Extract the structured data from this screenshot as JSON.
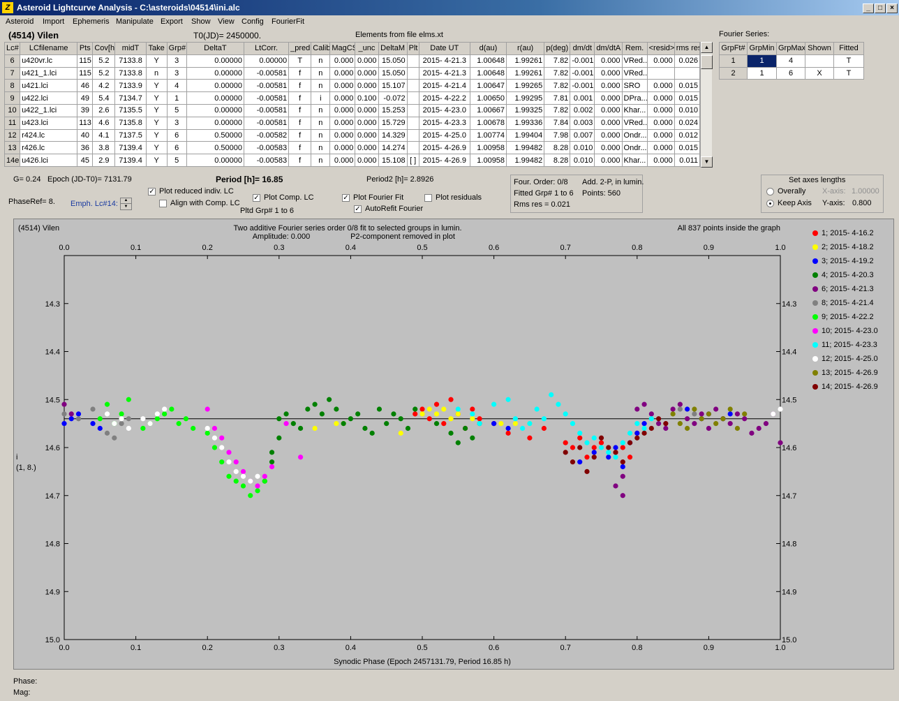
{
  "window": {
    "title": "Asteroid Lightcurve Analysis - C:\\asteroids\\04514\\ini.alc",
    "icon_label": "Z",
    "min": "_",
    "max": "□",
    "close": "×"
  },
  "menu": [
    "Asteroid",
    "Import",
    "Ephemeris",
    "Manipulate",
    "Export",
    "Show",
    "View",
    "Config",
    "FourierFit"
  ],
  "header": {
    "asteroid": "(4514) Vilen",
    "t0": "T0(JD)= 2450000.",
    "elements": "Elements from file elms.xt",
    "fourier_title": "Fourier Series:"
  },
  "lc_table": {
    "columns": [
      "Lc#",
      "LCfilename",
      "Pts",
      "Cov[h]",
      "midT",
      "Take",
      "Grp#",
      "DeltaT",
      "LtCorr.",
      "_pred.",
      "Calib.",
      "MagCS",
      "_unc",
      "DeltaM",
      "Plt",
      "Date UT",
      "d(au)",
      "r(au)",
      "p(deg)",
      "dm/dt",
      "dm/dtA",
      "Rem.",
      "<resid>",
      "rms res"
    ],
    "rows": [
      [
        "6",
        "u420vr.lc",
        "115",
        "5.2",
        "7133.8",
        "Y",
        "3",
        "0.00000",
        "0.00000",
        "T",
        "n",
        "0.000",
        "0.000",
        "15.050",
        "",
        "2015- 4-21.3",
        "1.00648",
        "1.99261",
        "7.82",
        "-0.001",
        "0.000",
        "VRed...",
        "0.000",
        "0.026"
      ],
      [
        "7",
        "u421_1.lci",
        "115",
        "5.2",
        "7133.8",
        "n",
        "3",
        "0.00000",
        "-0.00581",
        "f",
        "n",
        "0.000",
        "0.000",
        "15.050",
        "",
        "2015- 4-21.3",
        "1.00648",
        "1.99261",
        "7.82",
        "-0.001",
        "0.000",
        "VRed...",
        "",
        ""
      ],
      [
        "8",
        "u421.lci",
        "46",
        "4.2",
        "7133.9",
        "Y",
        "4",
        "0.00000",
        "-0.00581",
        "f",
        "n",
        "0.000",
        "0.000",
        "15.107",
        "",
        "2015- 4-21.4",
        "1.00647",
        "1.99265",
        "7.82",
        "-0.001",
        "0.000",
        "SRO",
        "0.000",
        "0.015"
      ],
      [
        "9",
        "u422.lci",
        "49",
        "5.4",
        "7134.7",
        "Y",
        "1",
        "0.00000",
        "-0.00581",
        "f",
        "i",
        "0.000",
        "0.100",
        "-0.072",
        "",
        "2015- 4-22.2",
        "1.00650",
        "1.99295",
        "7.81",
        "0.001",
        "0.000",
        "DPra...",
        "0.000",
        "0.015"
      ],
      [
        "10",
        "u422_1.lci",
        "39",
        "2.6",
        "7135.5",
        "Y",
        "5",
        "0.00000",
        "-0.00581",
        "f",
        "n",
        "0.000",
        "0.000",
        "15.253",
        "",
        "2015- 4-23.0",
        "1.00667",
        "1.99325",
        "7.82",
        "0.002",
        "0.000",
        "Khar...",
        "0.000",
        "0.010"
      ],
      [
        "11",
        "u423.lci",
        "113",
        "4.6",
        "7135.8",
        "Y",
        "3",
        "0.00000",
        "-0.00581",
        "f",
        "n",
        "0.000",
        "0.000",
        "15.729",
        "",
        "2015- 4-23.3",
        "1.00678",
        "1.99336",
        "7.84",
        "0.003",
        "0.000",
        "VRed...",
        "0.000",
        "0.024"
      ],
      [
        "12",
        "r424.lc",
        "40",
        "4.1",
        "7137.5",
        "Y",
        "6",
        "0.50000",
        "-0.00582",
        "f",
        "n",
        "0.000",
        "0.000",
        "14.329",
        "",
        "2015- 4-25.0",
        "1.00774",
        "1.99404",
        "7.98",
        "0.007",
        "0.000",
        "Ondr...",
        "0.000",
        "0.012"
      ],
      [
        "13",
        "r426.lc",
        "36",
        "3.8",
        "7139.4",
        "Y",
        "6",
        "0.50000",
        "-0.00583",
        "f",
        "n",
        "0.000",
        "0.000",
        "14.274",
        "",
        "2015- 4-26.9",
        "1.00958",
        "1.99482",
        "8.28",
        "0.010",
        "0.000",
        "Ondr...",
        "0.000",
        "0.015"
      ],
      [
        "14e",
        "u426.lci",
        "45",
        "2.9",
        "7139.4",
        "Y",
        "5",
        "0.00000",
        "-0.00583",
        "f",
        "n",
        "0.000",
        "0.000",
        "15.108",
        "[ ]",
        "2015- 4-26.9",
        "1.00958",
        "1.99482",
        "8.28",
        "0.010",
        "0.000",
        "Khar...",
        "0.000",
        "0.011"
      ]
    ]
  },
  "fourier_table": {
    "columns": [
      "GrpFt#",
      "GrpMin",
      "GrpMax",
      "Shown",
      "Fitted"
    ],
    "rows": [
      [
        "1",
        "1",
        "4",
        "",
        "T"
      ],
      [
        "2",
        "1",
        "6",
        "X",
        "T"
      ]
    ]
  },
  "controls": {
    "g": "G= 0.24",
    "epoch": "Epoch (JD-T0)= 7131.79",
    "period": "Period [h]= 16.85",
    "period2": "Period2 [h]= 2.8926",
    "phaseref": "PhaseRef= 8.",
    "emph": "Emph. Lc#14:",
    "plot_reduced": "Plot reduced indiv. LC",
    "align": "Align with Comp. LC",
    "plot_comp": "Plot Comp. LC",
    "pltd_grp": "Pltd Grp#  1   to   6",
    "plot_fourier": "Plot Fourier Fit",
    "autorefit": "AutoRefit Fourier",
    "plot_residuals": "Plot residuals",
    "four_order": "Four. Order:  0/8",
    "add2p": "Add. 2-P, in lumin.",
    "fitted_grp": "Fitted Grp# 1 to 6",
    "points": "Points: 560",
    "rms": "Rms res     = 0.021",
    "axes_title": "Set axes lengths",
    "overally": "Overally",
    "keep_axis": "Keep Axis",
    "xaxis_label": "X-axis:",
    "xaxis_val": "1.00000",
    "yaxis_label": "Y-axis:",
    "yaxis_val": "0.800",
    "checked_mark": "✓"
  },
  "chart_data": {
    "type": "scatter",
    "title_left": "(4514) Vilen",
    "title_center": "Two additive Fourier series order 0/8 fit to selected groups in lumin.",
    "subtitle_amp": "Amplitude: 0.000",
    "subtitle_p2": "P2-component removed in plot",
    "title_right": "All 837 points inside the graph",
    "xlabel": "Synodic Phase (Epoch 2457131.79, Period 16.85 h)",
    "ylabel": "i",
    "ylabel2": "(1, 8.)",
    "xlim": [
      0,
      1
    ],
    "ylim": [
      14.2,
      15.0
    ],
    "xticks": [
      "0.0",
      "0.1",
      "0.2",
      "0.3",
      "0.4",
      "0.5",
      "0.6",
      "0.7",
      "0.8",
      "0.9",
      "1.0"
    ],
    "yticks": [
      "14.3",
      "14.4",
      "14.5",
      "14.6",
      "14.7",
      "14.8",
      "14.9",
      "15.0"
    ],
    "fit_line": 14.54,
    "series": [
      {
        "name": "1; 2015- 4-16.2",
        "color": "#ff0000",
        "x": [
          0.49,
          0.5,
          0.51,
          0.52,
          0.53,
          0.54,
          0.55,
          0.56,
          0.57,
          0.58,
          0.6,
          0.62,
          0.65,
          0.67,
          0.7,
          0.71,
          0.72,
          0.73,
          0.74,
          0.75,
          0.77,
          0.78,
          0.79,
          0.8
        ],
        "y": [
          14.53,
          14.52,
          14.54,
          14.51,
          14.55,
          14.5,
          14.53,
          14.56,
          14.52,
          14.54,
          14.55,
          14.57,
          14.58,
          14.56,
          14.59,
          14.6,
          14.58,
          14.62,
          14.6,
          14.59,
          14.61,
          14.6,
          14.62,
          14.57
        ]
      },
      {
        "name": "2; 2015- 4-18.2",
        "color": "#ffff00",
        "x": [
          0.35,
          0.38,
          0.39,
          0.47,
          0.5,
          0.51,
          0.52,
          0.53,
          0.54,
          0.55,
          0.57,
          0.61,
          0.63,
          0.65
        ],
        "y": [
          14.56,
          14.55,
          14.55,
          14.57,
          14.53,
          14.52,
          14.53,
          14.52,
          14.54,
          14.53,
          14.54,
          14.55,
          14.55,
          14.55
        ]
      },
      {
        "name": "3; 2015- 4-19.2",
        "color": "#0000ff",
        "x": [
          0.0,
          0.01,
          0.02,
          0.04,
          0.05,
          0.6,
          0.62,
          0.72,
          0.74,
          0.76,
          0.77,
          0.78,
          0.79,
          0.8,
          0.81,
          0.87,
          0.89,
          0.9,
          0.92,
          0.93
        ],
        "y": [
          14.55,
          14.54,
          14.53,
          14.55,
          14.56,
          14.55,
          14.56,
          14.63,
          14.61,
          14.62,
          14.6,
          14.64,
          14.59,
          14.57,
          14.55,
          14.52,
          14.54,
          14.53,
          14.54,
          14.53
        ]
      },
      {
        "name": "4; 2015- 4-20.3",
        "color": "#008000",
        "x": [
          0.3,
          0.31,
          0.32,
          0.33,
          0.34,
          0.35,
          0.36,
          0.37,
          0.38,
          0.39,
          0.4,
          0.41,
          0.42,
          0.43,
          0.44,
          0.45,
          0.46,
          0.47,
          0.48,
          0.49,
          0.52,
          0.54,
          0.55,
          0.56,
          0.57,
          0.58,
          0.29,
          0.28,
          0.29,
          0.3
        ],
        "y": [
          14.54,
          14.53,
          14.55,
          14.56,
          14.52,
          14.51,
          14.53,
          14.5,
          14.52,
          14.55,
          14.54,
          14.53,
          14.56,
          14.57,
          14.52,
          14.55,
          14.53,
          14.54,
          14.56,
          14.52,
          14.55,
          14.57,
          14.59,
          14.56,
          14.58,
          14.55,
          14.63,
          14.67,
          14.61,
          14.58
        ]
      },
      {
        "name": "6; 2015- 4-21.3",
        "color": "#800080",
        "x": [
          0.0,
          0.01,
          0.8,
          0.81,
          0.82,
          0.83,
          0.84,
          0.85,
          0.86,
          0.87,
          0.88,
          0.89,
          0.9,
          0.91,
          0.92,
          0.93,
          0.94,
          0.95,
          0.96,
          0.97,
          0.98,
          0.99,
          1.0,
          0.78,
          0.77,
          0.78
        ],
        "y": [
          14.51,
          14.53,
          14.52,
          14.51,
          14.53,
          14.55,
          14.56,
          14.52,
          14.51,
          14.54,
          14.55,
          14.53,
          14.56,
          14.52,
          14.54,
          14.55,
          14.53,
          14.54,
          14.57,
          14.56,
          14.55,
          14.53,
          14.59,
          14.66,
          14.68,
          14.7
        ]
      },
      {
        "name": "8; 2015- 4-21.4",
        "color": "#808080",
        "x": [
          0.0,
          0.02,
          0.04,
          0.06,
          0.07,
          0.08,
          0.09,
          0.86,
          0.88
        ],
        "y": [
          14.53,
          14.54,
          14.52,
          14.57,
          14.58,
          14.55,
          14.54,
          14.52,
          14.53
        ]
      },
      {
        "name": "9; 2015- 4-22.2",
        "color": "#00ff00",
        "x": [
          0.05,
          0.06,
          0.07,
          0.08,
          0.09,
          0.11,
          0.12,
          0.13,
          0.14,
          0.15,
          0.16,
          0.17,
          0.18,
          0.2,
          0.21,
          0.22,
          0.23,
          0.24,
          0.25,
          0.26,
          0.27,
          0.28
        ],
        "y": [
          14.54,
          14.51,
          14.55,
          14.53,
          14.5,
          14.56,
          14.55,
          14.54,
          14.53,
          14.52,
          14.55,
          14.54,
          14.56,
          14.57,
          14.6,
          14.63,
          14.66,
          14.67,
          14.68,
          14.7,
          14.69,
          14.67
        ]
      },
      {
        "name": "10; 2015- 4-23.0",
        "color": "#ff00ff",
        "x": [
          0.2,
          0.21,
          0.22,
          0.23,
          0.24,
          0.25,
          0.26,
          0.27,
          0.28,
          0.29,
          0.31,
          0.33
        ],
        "y": [
          14.52,
          14.56,
          14.58,
          14.61,
          14.63,
          14.65,
          14.67,
          14.68,
          14.66,
          14.64,
          14.55,
          14.62
        ]
      },
      {
        "name": "11; 2015- 4-23.3",
        "color": "#00ffff",
        "x": [
          0.55,
          0.57,
          0.58,
          0.6,
          0.62,
          0.63,
          0.64,
          0.65,
          0.66,
          0.67,
          0.68,
          0.69,
          0.7,
          0.71,
          0.72,
          0.73,
          0.74,
          0.75,
          0.76,
          0.77,
          0.78,
          0.79,
          0.8,
          0.81,
          0.82
        ],
        "y": [
          14.52,
          14.53,
          14.55,
          14.51,
          14.5,
          14.54,
          14.56,
          14.55,
          14.52,
          14.54,
          14.49,
          14.51,
          14.53,
          14.55,
          14.57,
          14.59,
          14.58,
          14.6,
          14.61,
          14.62,
          14.59,
          14.57,
          14.55,
          14.56,
          14.54
        ]
      },
      {
        "name": "12; 2015- 4-25.0",
        "color": "#ffffff",
        "x": [
          0.06,
          0.07,
          0.08,
          0.09,
          0.11,
          0.12,
          0.13,
          0.14,
          0.2,
          0.21,
          0.22,
          0.23,
          0.24,
          0.25,
          0.26,
          0.27,
          0.99,
          1.0
        ],
        "y": [
          14.53,
          14.55,
          14.54,
          14.56,
          14.54,
          14.55,
          14.53,
          14.52,
          14.56,
          14.58,
          14.6,
          14.63,
          14.65,
          14.66,
          14.67,
          14.66,
          14.53,
          14.52
        ]
      },
      {
        "name": "13; 2015- 4-26.9",
        "color": "#808000",
        "x": [
          0.85,
          0.86,
          0.87,
          0.88,
          0.89,
          0.9,
          0.91,
          0.92,
          0.93,
          0.94,
          0.95
        ],
        "y": [
          14.53,
          14.55,
          14.56,
          14.52,
          14.54,
          14.53,
          14.55,
          14.54,
          14.52,
          14.56,
          14.53
        ]
      },
      {
        "name": "14; 2015- 4-26.9",
        "color": "#800000",
        "x": [
          0.7,
          0.71,
          0.72,
          0.73,
          0.74,
          0.75,
          0.76,
          0.77,
          0.78,
          0.79,
          0.8,
          0.81,
          0.82,
          0.83,
          0.84
        ],
        "y": [
          14.61,
          14.63,
          14.6,
          14.65,
          14.62,
          14.58,
          14.6,
          14.61,
          14.63,
          14.59,
          14.58,
          14.57,
          14.56,
          14.54,
          14.55
        ]
      }
    ]
  },
  "status": {
    "phase_label": "Phase:",
    "mag_label": "Mag:"
  }
}
